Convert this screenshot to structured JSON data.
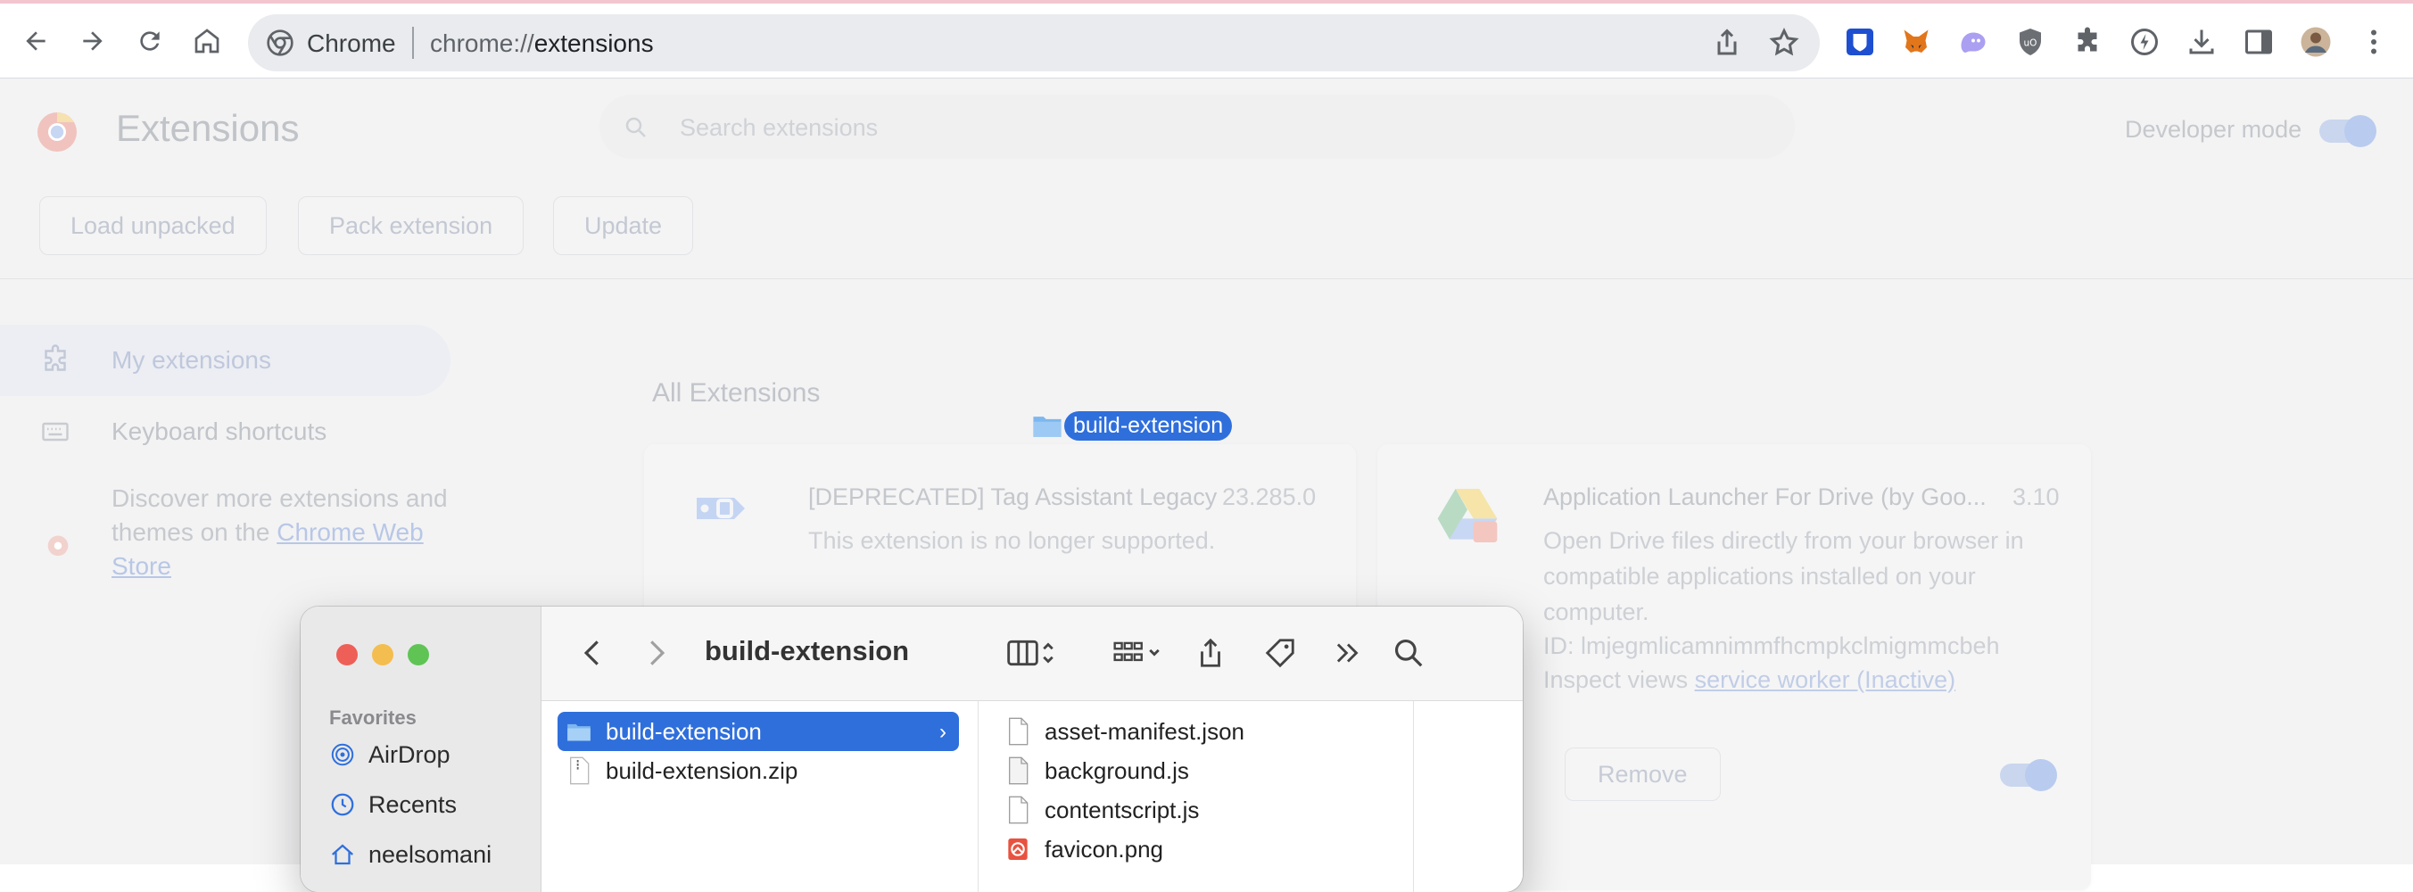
{
  "browser": {
    "omnibox": {
      "site_name": "Chrome",
      "url_scheme": "chrome://",
      "url_host": "extensions"
    },
    "icons": [
      "back-icon",
      "forward-icon",
      "reload-icon",
      "home-icon",
      "share-icon",
      "bookmark-star-icon",
      "bitwarden-icon",
      "metamask-icon",
      "phantom-icon",
      "ublock-icon",
      "extensions-puzzle-icon",
      "performance-icon",
      "downloads-icon",
      "side-panel-icon",
      "profile-avatar",
      "menu-kebab-icon"
    ]
  },
  "page": {
    "title": "Extensions",
    "search_placeholder": "Search extensions",
    "developer_mode_label": "Developer mode",
    "buttons": {
      "load_unpacked": "Load unpacked",
      "pack_extension": "Pack extension",
      "update": "Update"
    },
    "sidebar": {
      "my_extensions": "My extensions",
      "keyboard_shortcuts": "Keyboard shortcuts",
      "discover_text": "Discover more extensions and themes on the ",
      "discover_link": "Chrome Web Store"
    },
    "section_title": "All Extensions",
    "cards": [
      {
        "name": "[DEPRECATED] Tag Assistant Legacy",
        "version": "23.285.0",
        "description": "This extension is no longer supported."
      },
      {
        "name": "Application Launcher For Drive (by Goo...",
        "version": "3.10",
        "description": "Open Drive files directly from your browser in compatible applications installed on your computer.",
        "id": "ID: lmjegmlicamnimmfhcmpkclmigmmcbeh",
        "inspect_label": "Inspect views",
        "inspect_link": "service worker (Inactive)",
        "remove_label": "Remove"
      }
    ]
  },
  "drag_ghost": {
    "label": "build-extension"
  },
  "finder": {
    "title": "build-extension",
    "favorites_title": "Favorites",
    "favorites": [
      "AirDrop",
      "Recents",
      "neelsomani"
    ],
    "column1": [
      {
        "name": "build-extension",
        "kind": "folder",
        "selected": true
      },
      {
        "name": "build-extension.zip",
        "kind": "zip",
        "selected": false
      }
    ],
    "column2": [
      {
        "name": "asset-manifest.json",
        "kind": "file"
      },
      {
        "name": "background.js",
        "kind": "file"
      },
      {
        "name": "contentscript.js",
        "kind": "file"
      },
      {
        "name": "favicon.png",
        "kind": "image"
      }
    ]
  },
  "colors": {
    "accent": "#2f6fdc",
    "toolbar_top_stripe": "#f3c6cf",
    "omnibox_bg": "#e9ebee",
    "page_bg_dimmed": "#f3f3f4"
  }
}
